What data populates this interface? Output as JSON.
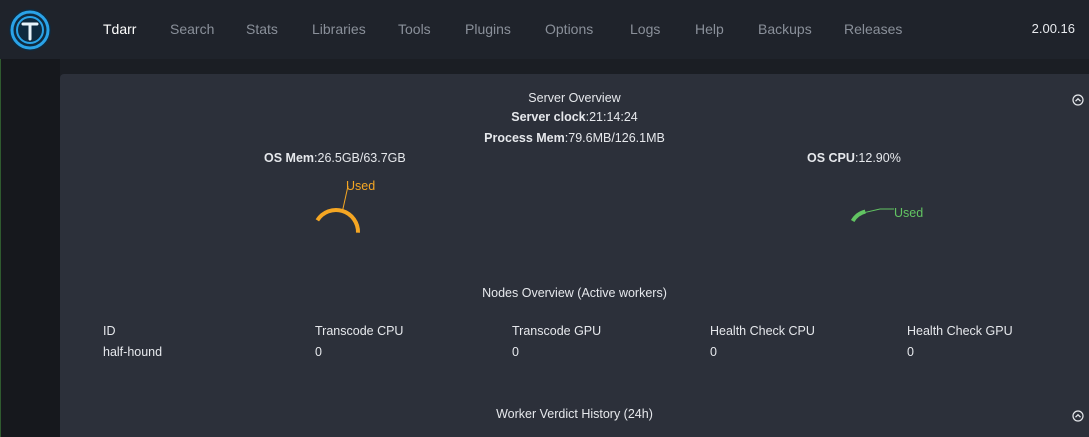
{
  "app": {
    "version": "2.00.16"
  },
  "nav": {
    "items": [
      {
        "label": "Tdarr",
        "active": true
      },
      {
        "label": "Search"
      },
      {
        "label": "Stats"
      },
      {
        "label": "Libraries"
      },
      {
        "label": "Tools"
      },
      {
        "label": "Plugins"
      },
      {
        "label": "Options"
      },
      {
        "label": "Logs"
      },
      {
        "label": "Help"
      },
      {
        "label": "Backups"
      },
      {
        "label": "Releases"
      }
    ]
  },
  "server": {
    "title": "Server Overview",
    "clock_label": "Server clock",
    "clock_value": ":21:14:24",
    "process_mem_label": "Process Mem",
    "process_mem_value": ":79.6MB/126.1MB",
    "os_mem_label": "OS Mem",
    "os_mem_value": ":26.5GB/63.7GB",
    "os_cpu_label": "OS CPU",
    "os_cpu_value": ":12.90%",
    "mem_gauge": {
      "label": "Used",
      "fraction": 0.416,
      "color": "#f5a623"
    },
    "cpu_gauge": {
      "label": "Used",
      "fraction": 0.129,
      "color": "#62c462"
    }
  },
  "nodes": {
    "title": "Nodes Overview (Active workers)",
    "columns": [
      "ID",
      "Transcode CPU",
      "Transcode GPU",
      "Health Check CPU",
      "Health Check GPU"
    ],
    "rows": [
      [
        "half-hound",
        "0",
        "0",
        "0",
        "0"
      ]
    ]
  },
  "history": {
    "title": "Worker Verdict History (24h)"
  },
  "colors": {
    "accent_blue": "#1e90d6",
    "mem_orange": "#f5a623",
    "cpu_green": "#62c462"
  }
}
